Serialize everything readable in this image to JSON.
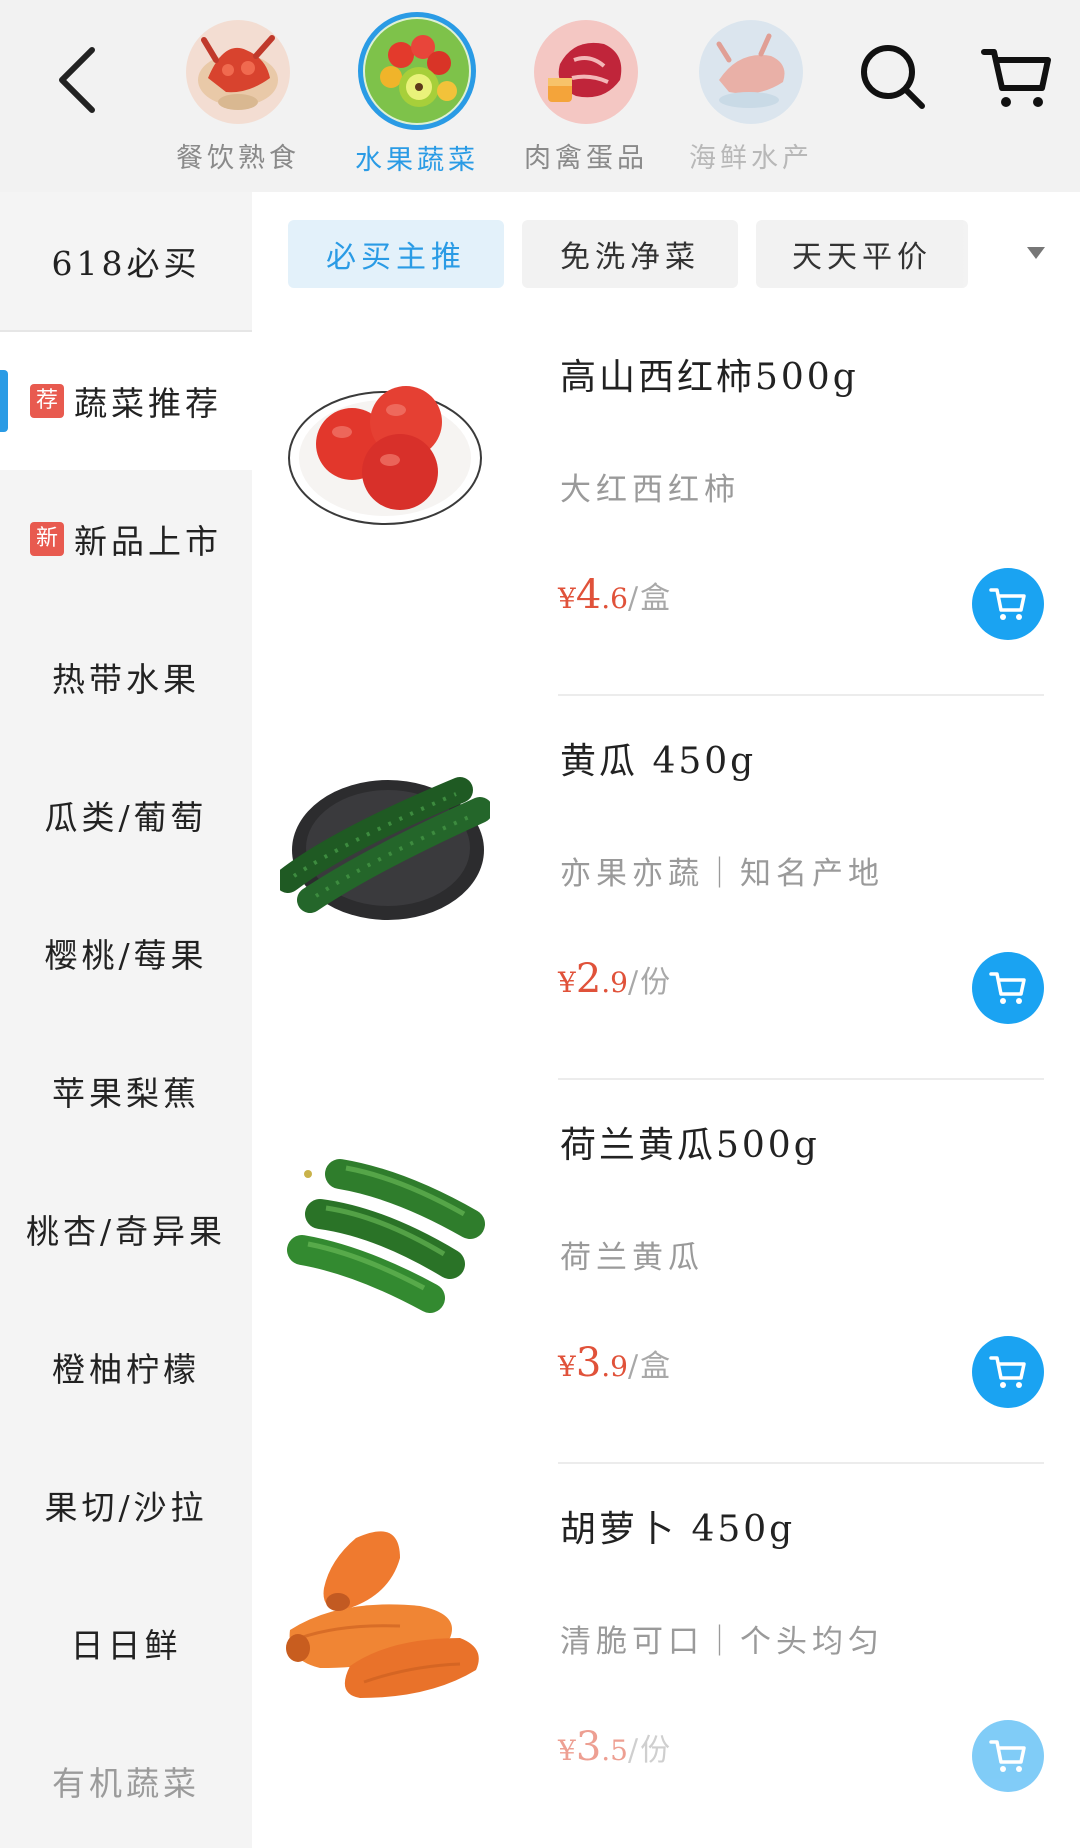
{
  "header": {
    "categories": [
      {
        "label": "餐饮熟食",
        "icon": "seafood-dish-icon"
      },
      {
        "label": "水果蔬菜",
        "icon": "fruit-veg-icon"
      },
      {
        "label": "肉禽蛋品",
        "icon": "meat-icon"
      },
      {
        "label": "海鲜水产",
        "icon": "seafood-icon"
      }
    ]
  },
  "sidebar": {
    "items": [
      {
        "label": "618必买",
        "badge": ""
      },
      {
        "label": "蔬菜推荐",
        "badge": "荐"
      },
      {
        "label": "新品上市",
        "badge": "新"
      },
      {
        "label": "热带水果",
        "badge": ""
      },
      {
        "label": "瓜类/葡萄",
        "badge": ""
      },
      {
        "label": "樱桃/莓果",
        "badge": ""
      },
      {
        "label": "苹果梨蕉",
        "badge": ""
      },
      {
        "label": "桃杏/奇异果",
        "badge": ""
      },
      {
        "label": "橙柚柠檬",
        "badge": ""
      },
      {
        "label": "果切/沙拉",
        "badge": ""
      },
      {
        "label": "日日鲜",
        "badge": ""
      },
      {
        "label": "有机蔬菜",
        "badge": ""
      }
    ],
    "active_index": 1
  },
  "subtabs": {
    "items": [
      "必买主推",
      "免洗净菜",
      "天天平价"
    ],
    "active_index": 0
  },
  "products": [
    {
      "name": "高山西红柿500g",
      "desc": "大红西红柿",
      "currency": "¥",
      "price_int": "4",
      "price_dec": ".6",
      "unit": "/盒",
      "image": "tomato-image"
    },
    {
      "name": "黄瓜 450g",
      "desc": "亦果亦蔬｜知名产地",
      "currency": "¥",
      "price_int": "2",
      "price_dec": ".9",
      "unit": "/份",
      "image": "cucumber-image"
    },
    {
      "name": "荷兰黄瓜500g",
      "desc": "荷兰黄瓜",
      "currency": "¥",
      "price_int": "3",
      "price_dec": ".9",
      "unit": "/盒",
      "image": "dutch-cucumber-image"
    },
    {
      "name": "胡萝卜 450g",
      "desc": "清脆可口｜个头均匀",
      "currency": "¥",
      "price_int": "3",
      "price_dec": ".5",
      "unit": "/份",
      "image": "carrot-image"
    }
  ],
  "colors": {
    "accent": "#2a9be5",
    "price": "#e0523a",
    "cart_button": "#1aa3f2",
    "badge": "#e85a4f"
  }
}
